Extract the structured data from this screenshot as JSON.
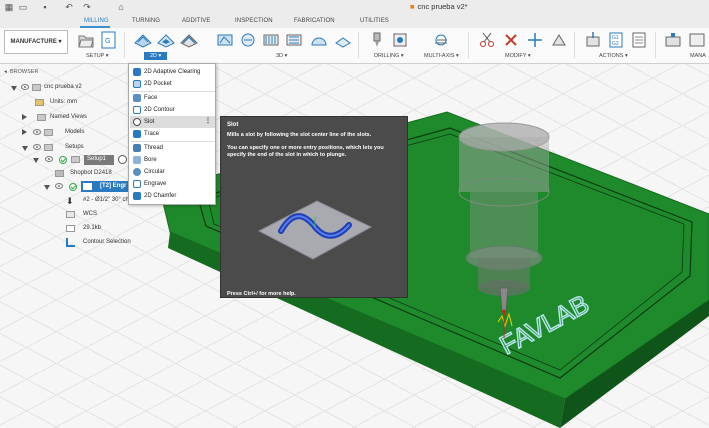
{
  "document": {
    "title": "cnc prueba v2*"
  },
  "tabs": [
    {
      "label": "MILLING",
      "active": true
    },
    {
      "label": "TURNING"
    },
    {
      "label": "ADDITIVE"
    },
    {
      "label": "INSPECTION"
    },
    {
      "label": "FABRICATION"
    },
    {
      "label": "UTILITIES"
    }
  ],
  "ribbon": {
    "workspace_label": "MANUFACTURE",
    "groups": {
      "setup": "SETUP",
      "twod": "2D",
      "threed": "3D",
      "drilling": "DRILLING",
      "multiaxis": "MULTI-AXIS",
      "modify": "MODIFY",
      "actions": "ACTIONS",
      "manage": "MANA"
    },
    "accent_color": "#2a7ac0"
  },
  "browser": {
    "header": "BROWSER",
    "items": [
      {
        "label": "cnc prueba v2"
      },
      {
        "label": "Units: mm"
      },
      {
        "label": "Named Views"
      },
      {
        "label": "Models"
      },
      {
        "label": "Setups"
      },
      {
        "label": "Setup1"
      },
      {
        "label": "Shopbot D2418"
      },
      {
        "label": "[T2] Engr"
      },
      {
        "label": "#2 - Ø1/2\" 30° ch"
      },
      {
        "label": "WCS"
      },
      {
        "label": "29.1kb"
      },
      {
        "label": "Contour Selection"
      }
    ]
  },
  "dropdown": {
    "items": [
      {
        "label": "2D Adaptive Clearing",
        "icon": "adaptive-clearing-icon"
      },
      {
        "label": "2D Pocket",
        "icon": "pocket-icon"
      },
      {
        "label": "Face",
        "icon": "face-icon"
      },
      {
        "label": "2D Contour",
        "icon": "contour-icon"
      },
      {
        "label": "Slot",
        "icon": "slot-icon",
        "selected": true,
        "more": "⋮"
      },
      {
        "label": "Trace",
        "icon": "trace-icon"
      },
      {
        "label": "Thread",
        "icon": "thread-icon"
      },
      {
        "label": "Bore",
        "icon": "bore-icon"
      },
      {
        "label": "Circular",
        "icon": "circular-icon"
      },
      {
        "label": "Engrave",
        "icon": "engrave-icon"
      },
      {
        "label": "2D Chamfer",
        "icon": "chamfer-icon"
      }
    ]
  },
  "tooltip": {
    "title": "Slot",
    "description": "Mills a slot by following the slot center line of the slots.",
    "detail": "You can specify one or more entry positions, which lets you specify the end of the slot in which to plunge.",
    "footer": "Press Ctrl+/ for more help."
  },
  "viewport": {
    "engraving_text": "FAVLAB",
    "board_color": "#1f8a2c"
  }
}
